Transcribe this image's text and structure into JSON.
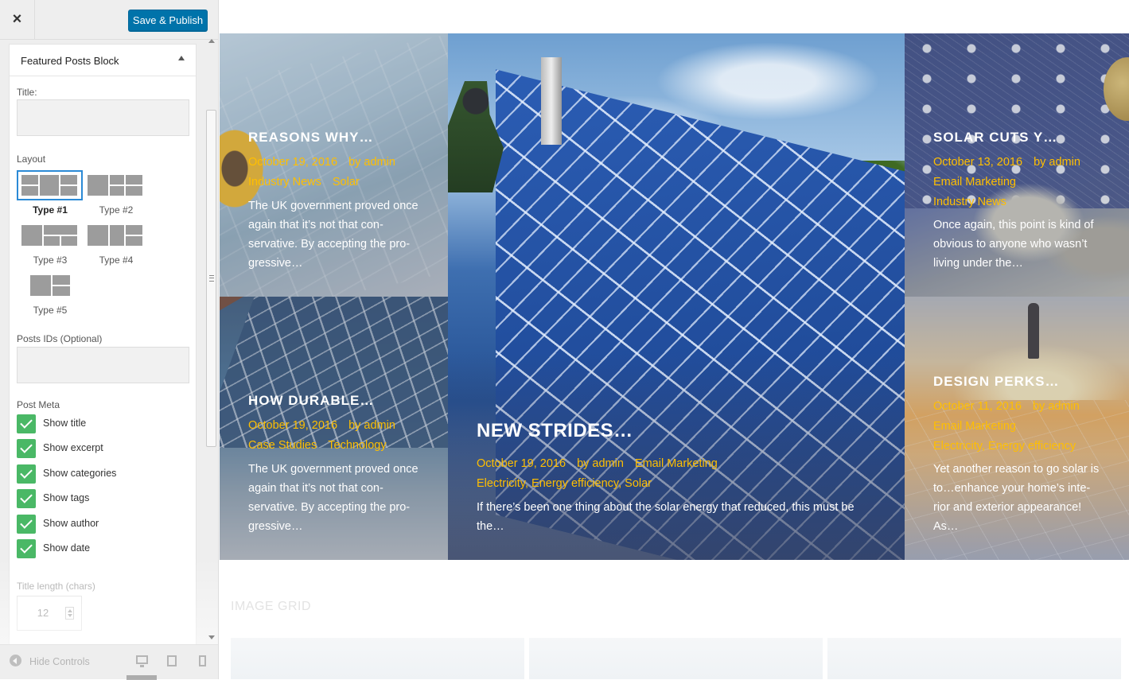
{
  "sidebar": {
    "close_label": "×",
    "save_label": "Save & Publish",
    "section_title": "Featured Posts Block",
    "title_label": "Title:",
    "title_value": "",
    "layout_label": "Layout",
    "layouts": [
      {
        "label": "Type #1",
        "selected": true
      },
      {
        "label": "Type #2",
        "selected": false
      },
      {
        "label": "Type #3",
        "selected": false
      },
      {
        "label": "Type #4",
        "selected": false
      },
      {
        "label": "Type #5",
        "selected": false
      }
    ],
    "posts_ids_label": "Posts IDs (Optional)",
    "posts_ids_value": "",
    "post_meta_label": "Post Meta",
    "meta_options": [
      {
        "label": "Show title",
        "checked": true
      },
      {
        "label": "Show excerpt",
        "checked": true
      },
      {
        "label": "Show categories",
        "checked": true
      },
      {
        "label": "Show tags",
        "checked": true
      },
      {
        "label": "Show author",
        "checked": true
      },
      {
        "label": "Show date",
        "checked": true
      }
    ],
    "title_length_label": "Title length (chars)",
    "title_length_value": "12",
    "footer": {
      "hide_controls_label": "Hide Controls",
      "devices": [
        "desktop-icon",
        "tablet-icon",
        "mobile-icon"
      ]
    },
    "colors": {
      "primary_button": "#0073aa",
      "checkbox": "#4ab866",
      "selected_outline": "#2b8ad6"
    }
  },
  "preview": {
    "posts": [
      {
        "title": "REASONS WHY…",
        "date": "October 19, 2016",
        "author": "by admin",
        "categories": [
          "Industry News",
          "Solar"
        ],
        "excerpt": "The UK government proved once again that it’s not that con-servative. By accepting the pro-gressive…"
      },
      {
        "title": "HOW DURABLE…",
        "date": "October 19, 2016",
        "author": "by admin",
        "categories": [
          "Case Studies",
          "Technology"
        ],
        "excerpt": "The UK government proved once again that it’s not that con-servative. By accepting the pro-gressive…"
      },
      {
        "title": "NEW STRIDES…",
        "date": "October 19, 2016",
        "author": "by admin",
        "category_primary": "Email Marketing",
        "category_secondary": "Electricity, Energy efficiency, Solar",
        "excerpt": "If there’s been one thing about the solar energy that reduced, this must be the…"
      },
      {
        "title": "SOLAR CUTS Y…",
        "date": "October 13, 2016",
        "author": "by admin",
        "category_line_1": "Email Marketing",
        "category_line_2": "Industry News",
        "excerpt": "Once again, this point is kind of obvious to anyone who wasn’t living under the…"
      },
      {
        "title": "DESIGN PERKS…",
        "date": "October 11, 2016",
        "author": "by admin",
        "category_line_1": "Email Marketing",
        "category_line_2": "Electricity, Energy efficiency",
        "excerpt": "Yet another reason to go solar is to…enhance your home’s inte-rior and exterior appearance! As…"
      }
    ],
    "next_section_heading": "IMAGE GRID",
    "colors": {
      "meta_text": "#ffbf00"
    }
  }
}
